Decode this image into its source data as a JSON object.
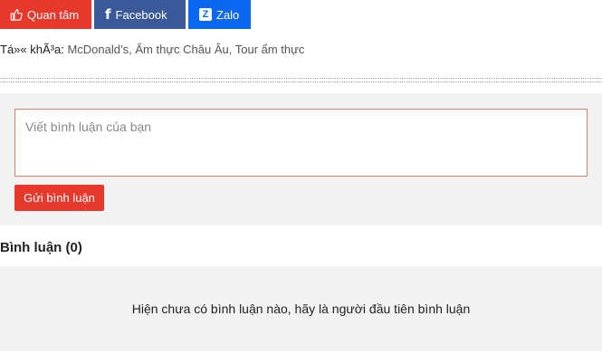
{
  "share": {
    "like_label": "Quan tâm",
    "facebook_label": "Facebook",
    "zalo_label": "Zalo",
    "zalo_glyph": "Z",
    "like_icon": "thumbs-up-icon",
    "facebook_icon": "facebook-icon",
    "zalo_icon": "zalo-icon",
    "colors": {
      "like": "#e8372b",
      "facebook": "#3b5998",
      "zalo": "#0a68f3"
    }
  },
  "tags": {
    "label": "Tá»« khÃ³a:",
    "items": [
      "McDonald’s",
      "Ẩm thực Châu Âu",
      "Tour ẩm thực"
    ]
  },
  "comment_form": {
    "placeholder": "Viết bình luận của bạn",
    "submit_label": "Gửi bình luận"
  },
  "comments": {
    "title": "Bình luận (0)",
    "empty_message": "Hiện chưa có bình luận nào, hãy là người đầu tiên bình luận"
  }
}
